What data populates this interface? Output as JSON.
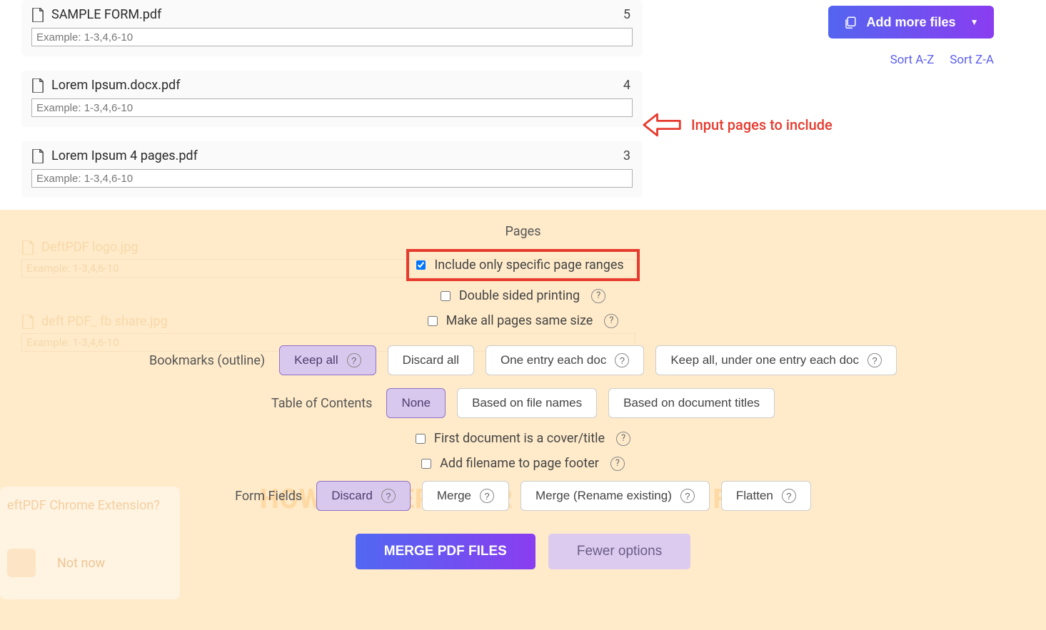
{
  "files": [
    {
      "name": "SAMPLE FORM.pdf",
      "pages": "5",
      "placeholder": "Example: 1-3,4,6-10"
    },
    {
      "name": "Lorem Ipsum.docx.pdf",
      "pages": "4",
      "placeholder": "Example: 1-3,4,6-10"
    },
    {
      "name": "Lorem Ipsum 4 pages.pdf",
      "pages": "3",
      "placeholder": "Example: 1-3,4,6-10"
    }
  ],
  "ghost_files": [
    {
      "name": "DeftPDF logo.jpg",
      "placeholder": "Example: 1-3,4,6-10"
    },
    {
      "name": "deft PDF_ fb share.jpg",
      "placeholder": "Example: 1-3,4,6-10"
    }
  ],
  "controls": {
    "add_more": "Add more files",
    "sort_az": "Sort A-Z",
    "sort_za": "Sort Z-A"
  },
  "annotation": "Input pages to include",
  "sections": {
    "pages_label": "Pages",
    "include_ranges": "Include only specific page ranges",
    "double_sided": "Double sided printing",
    "same_size": "Make all pages same size",
    "bookmarks_label": "Bookmarks (outline)",
    "bm_keep_all": "Keep all",
    "bm_discard": "Discard all",
    "bm_one_each": "One entry each doc",
    "bm_keep_under": "Keep all, under one entry each doc",
    "toc_label": "Table of Contents",
    "toc_none": "None",
    "toc_files": "Based on file names",
    "toc_titles": "Based on document titles",
    "first_cover": "First document is a cover/title",
    "add_filename_footer": "Add filename to page footer",
    "ff_label": "Form Fields",
    "ff_discard": "Discard",
    "ff_merge": "Merge",
    "ff_merge_rename": "Merge (Rename existing)",
    "ff_flatten": "Flatten",
    "merge_cta": "MERGE PDF FILES",
    "fewer": "Fewer options"
  },
  "big_title": "HOW TO MERGE OR COMBINE PDF FILES",
  "prompt": {
    "text": "eftPDF Chrome Extension?",
    "notnow": "Not now"
  }
}
